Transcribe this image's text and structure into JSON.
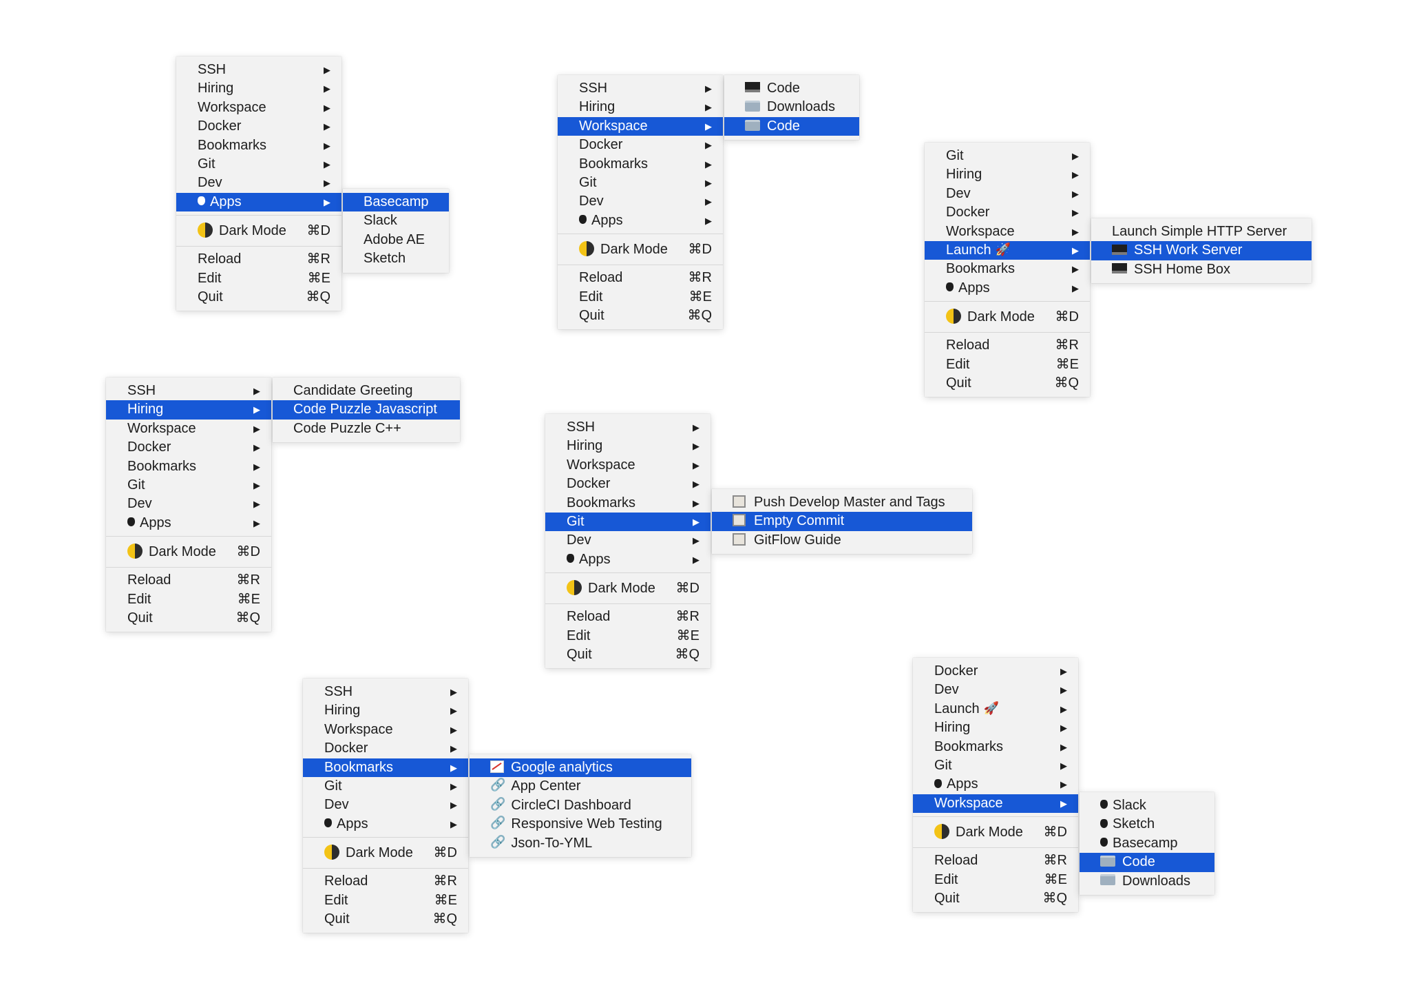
{
  "common": {
    "dark_mode": "Dark Mode",
    "dark_mode_shortcut": "⌘D",
    "reload": "Reload",
    "reload_shortcut": "⌘R",
    "edit": "Edit",
    "edit_shortcut": "⌘E",
    "quit": "Quit",
    "quit_shortcut": "⌘Q",
    "submenu_arrow": "▶"
  },
  "labels": {
    "ssh": "SSH",
    "hiring": "Hiring",
    "workspace": "Workspace",
    "docker": "Docker",
    "bookmarks": "Bookmarks",
    "git": "Git",
    "dev": "Dev",
    "apps": "Apps",
    "launch": "Launch"
  },
  "menu_apps": {
    "submenu": [
      "Basecamp",
      "Slack",
      "Adobe AE",
      "Sketch"
    ]
  },
  "menu_workspace": {
    "submenu": [
      "Code",
      "Downloads",
      "Code"
    ]
  },
  "menu_launch": {
    "submenu": [
      "Launch Simple HTTP Server",
      "SSH Work Server",
      "SSH Home Box"
    ]
  },
  "menu_hiring": {
    "submenu": [
      "Candidate Greeting",
      "Code Puzzle Javascript",
      "Code Puzzle C++"
    ]
  },
  "menu_git": {
    "submenu": [
      "Push Develop Master and Tags",
      "Empty Commit",
      "GitFlow Guide"
    ]
  },
  "menu_bookmarks": {
    "submenu": [
      "Google analytics",
      "App Center",
      "CircleCI Dashboard",
      "Responsive Web Testing",
      "Json-To-YML"
    ]
  },
  "menu_workspace2": {
    "submenu": [
      "Slack",
      "Sketch",
      "Basecamp",
      "Code",
      "Downloads"
    ]
  },
  "colors": {
    "selection": "#1758d6",
    "menu_background": "#f2f2f2"
  }
}
